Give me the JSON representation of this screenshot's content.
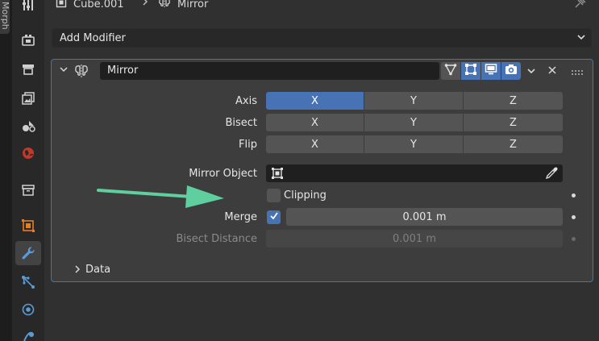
{
  "edge_tab": {
    "label": "Morph"
  },
  "header": {
    "object_name": "Cube.001",
    "modifier_name": "Mirror"
  },
  "add_modifier": {
    "label": "Add Modifier"
  },
  "modifier": {
    "name": "Mirror",
    "axis_label": "Axis",
    "bisect_label": "Bisect",
    "flip_label": "Flip",
    "axis_buttons": [
      "X",
      "Y",
      "Z"
    ],
    "axis_selected": "X",
    "mirror_object_label": "Mirror Object",
    "clipping_label": "Clipping",
    "clipping_checked": false,
    "merge_label": "Merge",
    "merge_checked": true,
    "merge_value": "0.001 m",
    "bisect_distance_label": "Bisect Distance",
    "bisect_distance_value": "0.001 m",
    "data_label": "Data"
  },
  "colors": {
    "accent": "#4772b3",
    "arrow": "#5fcf9f"
  },
  "toolbar_icons": [
    "tool-icon",
    "render-icon",
    "output-icon",
    "view-layer-icon",
    "scene-icon",
    "world-icon",
    "collection-icon",
    "object-icon",
    "modifier-icon",
    "particles-icon",
    "physics-icon",
    "constraints-icon"
  ]
}
